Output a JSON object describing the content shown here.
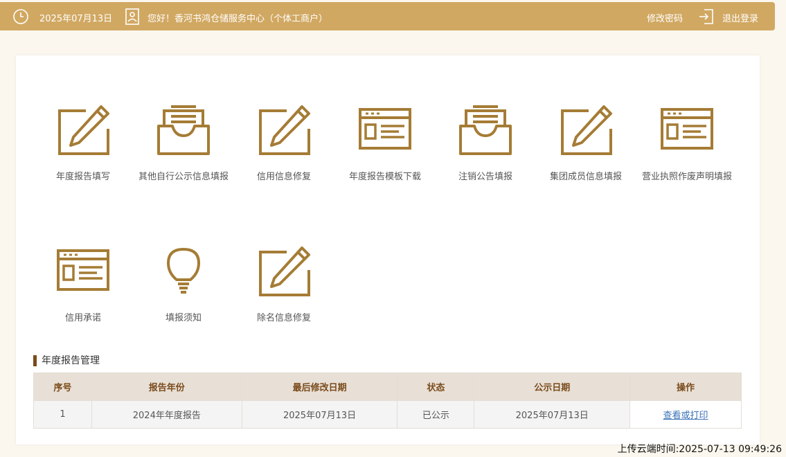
{
  "header": {
    "date": "2025年07月13日",
    "greeting": "您好！香河书鸿仓储服务中心（个体工商户）",
    "change_password": "修改密码",
    "logout": "退出登录",
    "clock_icon": "clock-icon",
    "user_icon": "user-id-icon",
    "logout_icon": "logout-icon"
  },
  "tiles": [
    {
      "label": "年度报告填写",
      "icon": "edit-pencil-icon"
    },
    {
      "label": "其他自行公示信息填报",
      "icon": "inbox-tray-icon"
    },
    {
      "label": "信用信息修复",
      "icon": "edit-pencil-icon"
    },
    {
      "label": "年度报告模板下载",
      "icon": "document-template-icon"
    },
    {
      "label": "注销公告填报",
      "icon": "inbox-tray-icon"
    },
    {
      "label": "集团成员信息填报",
      "icon": "edit-pencil-icon"
    },
    {
      "label": "营业执照作废声明填报",
      "icon": "document-template-icon"
    },
    {
      "label": "信用承诺",
      "icon": "document-template-icon"
    },
    {
      "label": "填报须知",
      "icon": "lightbulb-icon"
    },
    {
      "label": "除名信息修复",
      "icon": "edit-pencil-icon"
    }
  ],
  "report_section": {
    "title": "年度报告管理",
    "columns": [
      "序号",
      "报告年份",
      "最后修改日期",
      "状态",
      "公示日期",
      "操作"
    ],
    "rows": [
      {
        "index": "1",
        "year": "2024年年度报告",
        "modified": "2025年07月13日",
        "status": "已公示",
        "publish_date": "2025年07月13日",
        "action": "查看或打印"
      }
    ]
  },
  "footer": {
    "upload_time": "上传云端时间:2025-07-13 09:49:26"
  },
  "colors": {
    "header_bg": "#d1a862",
    "icon_gold": "#a57c35",
    "table_header_bg": "#e8e0d6",
    "accent_brown": "#7a4b1c",
    "link": "#3a72b8"
  }
}
